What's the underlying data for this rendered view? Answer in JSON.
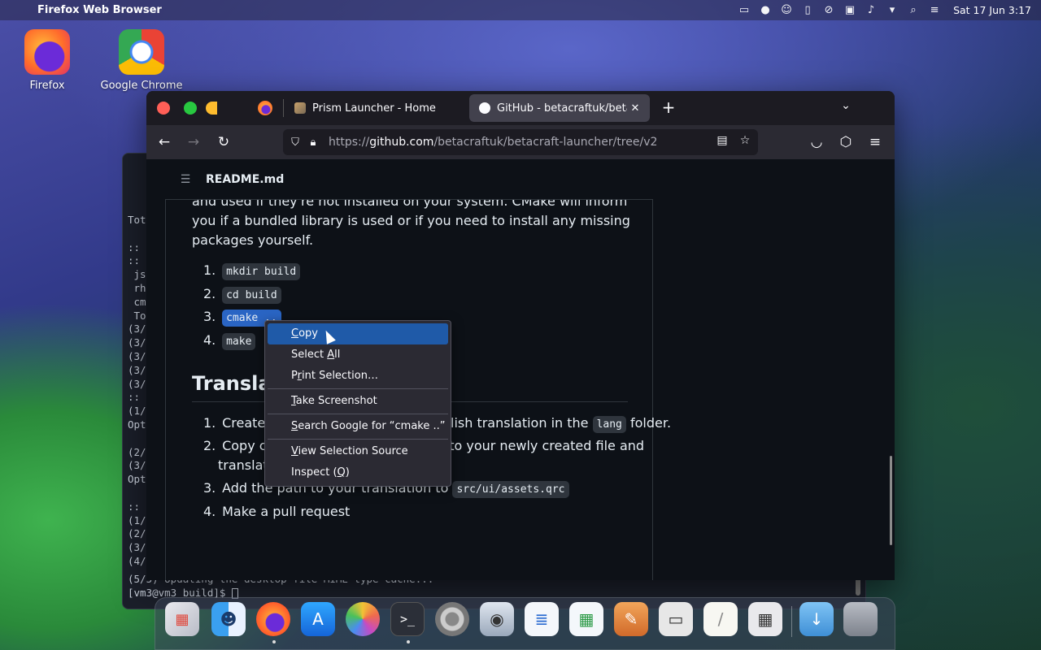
{
  "menubar": {
    "apple": "",
    "app_name": "Firefox Web Browser",
    "clock": "Sat 17 Jun  3:17",
    "tray_icons": [
      "battery-icon",
      "user-icon",
      "accessibility-icon",
      "clipboard-icon",
      "network-off-icon",
      "display-icon",
      "volume-icon",
      "dropdown-icon",
      "search-icon",
      "control-center-icon"
    ]
  },
  "desktop": {
    "icons": [
      {
        "label": "Firefox"
      },
      {
        "label": "Google Chrome"
      }
    ]
  },
  "terminal": {
    "lines": [
      "Tot",
      "",
      "::",
      "::",
      " js",
      " rh",
      " cm",
      " To",
      "(3/",
      "(3/",
      "(3/",
      "(3/",
      "(3/",
      "::",
      "(1/",
      "Opt",
      "",
      "(2/",
      "(3/",
      "Opt",
      "",
      "::",
      "(1/",
      "(2/",
      "(3/",
      "(4/"
    ],
    "bottom_lines": [
      "(5/5) Updating the desktop file MIME type cache...",
      "[vm3@vm3 build]$ "
    ]
  },
  "browser": {
    "tabs": [
      {
        "title": "Prism Launcher - Home",
        "active": false
      },
      {
        "title": "GitHub - betacraftuk/betacraft-launcher",
        "active": true
      }
    ],
    "new_tab": "+",
    "url_prefix": "https://",
    "url_host": "github.com",
    "url_path": "/betacraftuk/betacraft-launcher/tree/v2"
  },
  "readme": {
    "title": "README.md",
    "paragraph": "and used if they're not installed on your system. CMake will inform you if a bundled library is used or if you need to install any missing packages yourself.",
    "build_steps": [
      {
        "num": "1.",
        "code": "mkdir build"
      },
      {
        "num": "2.",
        "code": "cd build"
      },
      {
        "num": "3.",
        "code": "cmake .."
      },
      {
        "num": "4.",
        "code": "make"
      }
    ],
    "heading": "Translations",
    "translation_steps": [
      {
        "num": "1.",
        "pre": "Create a new file based on the English translation in the ",
        "code": "lang",
        "post": " folder."
      },
      {
        "num": "2.",
        "text": "Copy contents of the English file into your newly created file and",
        "text2": "translate it"
      },
      {
        "num": "3.",
        "pre": "Add the path to your translation to ",
        "code": "src/ui/assets.qrc",
        "post": ""
      },
      {
        "num": "4.",
        "text": "Make a pull request"
      }
    ]
  },
  "context_menu": {
    "items": [
      {
        "label": "Copy",
        "u": "C",
        "rest": "opy",
        "pre": ""
      },
      {
        "label": "Select All",
        "pre": "Select ",
        "u": "A",
        "rest": "ll"
      },
      {
        "label": "Print Selection…",
        "pre": "P",
        "u": "r",
        "rest": "int Selection…"
      },
      {
        "label": "Take Screenshot",
        "pre": "",
        "u": "T",
        "rest": "ake Screenshot"
      },
      {
        "label": "Search Google for “cmake ..”",
        "pre": "",
        "u": "S",
        "rest": "earch Google for “cmake ..”"
      },
      {
        "label": "View Selection Source",
        "pre": "",
        "u": "V",
        "rest": "iew Selection Source"
      },
      {
        "label": "Inspect (Q)",
        "pre": "Inspect (",
        "u": "Q",
        "rest": ")"
      }
    ]
  },
  "dock": {
    "apps": [
      "launchpad-icon",
      "finder-icon",
      "firefox-icon",
      "app-store-icon",
      "photos-icon",
      "terminal-icon",
      "settings-icon",
      "preview-icon",
      "writer-icon",
      "calc-icon",
      "paint-icon",
      "cassette-icon",
      "notes-icon",
      "calculator-icon",
      "downloads-icon",
      "trash-icon"
    ]
  }
}
